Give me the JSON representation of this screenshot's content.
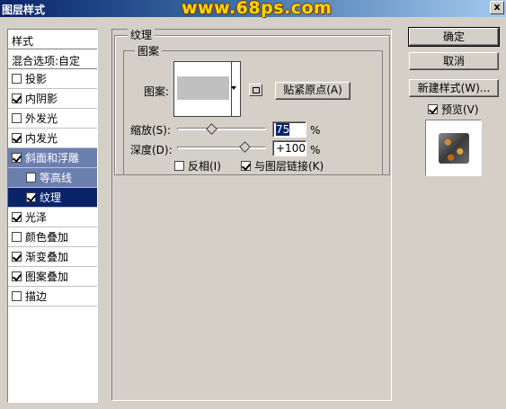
{
  "window": {
    "title": "图层样式",
    "watermark": "www.68ps.com",
    "close_glyph": "x"
  },
  "left_panel": {
    "header": "样式",
    "blend_options": "混合选项:自定",
    "items": [
      {
        "label": "投影",
        "checked": false,
        "sub": false,
        "state": ""
      },
      {
        "label": "内阴影",
        "checked": true,
        "sub": false,
        "state": ""
      },
      {
        "label": "外发光",
        "checked": false,
        "sub": false,
        "state": ""
      },
      {
        "label": "内发光",
        "checked": true,
        "sub": false,
        "state": ""
      },
      {
        "label": "斜面和浮雕",
        "checked": true,
        "sub": false,
        "state": "hl"
      },
      {
        "label": "等高线",
        "checked": false,
        "sub": true,
        "state": "hl"
      },
      {
        "label": "纹理",
        "checked": true,
        "sub": true,
        "state": "sel"
      },
      {
        "label": "光泽",
        "checked": true,
        "sub": false,
        "state": ""
      },
      {
        "label": "颜色叠加",
        "checked": false,
        "sub": false,
        "state": ""
      },
      {
        "label": "渐变叠加",
        "checked": true,
        "sub": false,
        "state": ""
      },
      {
        "label": "图案叠加",
        "checked": true,
        "sub": false,
        "state": ""
      },
      {
        "label": "描边",
        "checked": false,
        "sub": false,
        "state": ""
      }
    ]
  },
  "texture": {
    "group_title": "纹理",
    "pattern_group_title": "图案",
    "pattern_label": "图案:",
    "snap_origin_button": "贴紧原点(A)",
    "scale_label": "缩放(S):",
    "scale_value": "75",
    "scale_level": 75,
    "depth_label": "深度(D):",
    "depth_value": "+100",
    "depth_level": 100,
    "percent": "%",
    "invert_label": "反相(I)",
    "invert_checked": false,
    "link_label": "与图层链接(K)",
    "link_checked": true
  },
  "buttons": {
    "ok": "确定",
    "cancel": "取消",
    "new_style": "新建样式(W)...",
    "preview_label": "预览(V)",
    "preview_checked": true
  }
}
